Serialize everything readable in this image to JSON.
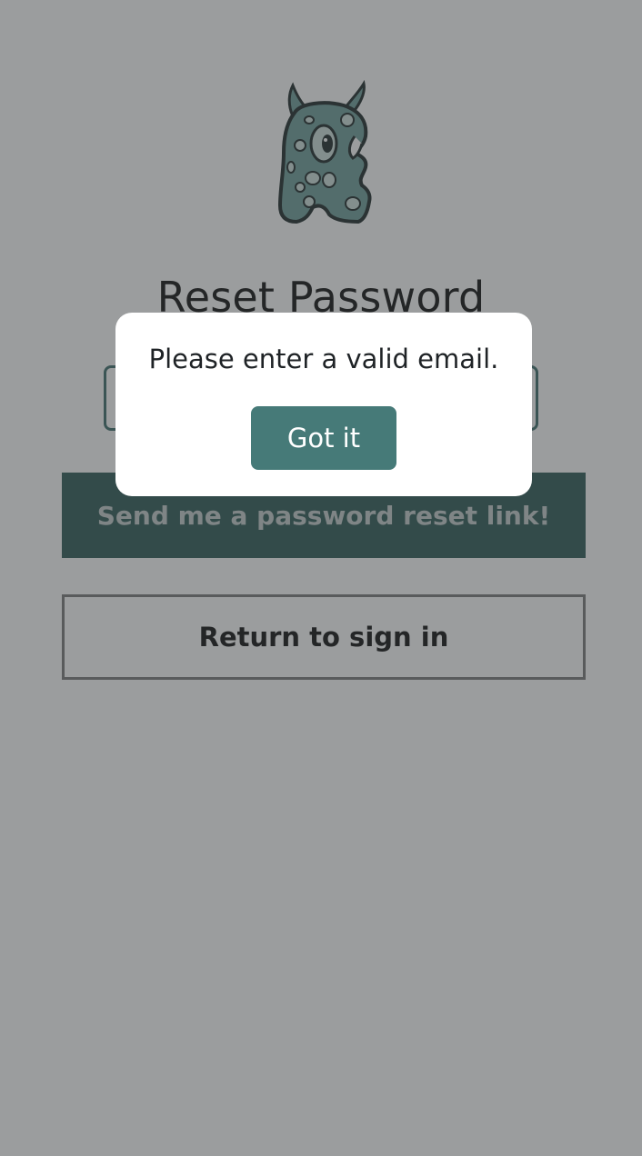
{
  "logo": {
    "icon": "monster-icon",
    "colors": {
      "body": "#6f9e9a",
      "outline": "#1f2a2a",
      "spot": "#cfe0dd"
    }
  },
  "page": {
    "title": "Reset Password"
  },
  "form": {
    "email_value": "",
    "email_placeholder": "",
    "send_label": "Send me a password reset link!",
    "return_label": "Return to sign in"
  },
  "dialog": {
    "message": "Please enter a valid email.",
    "button_label": "Got it"
  },
  "colors": {
    "primary": "#2f5a57",
    "dialog_button": "#467a78",
    "overlay": "rgba(55,60,62,0.5)"
  }
}
